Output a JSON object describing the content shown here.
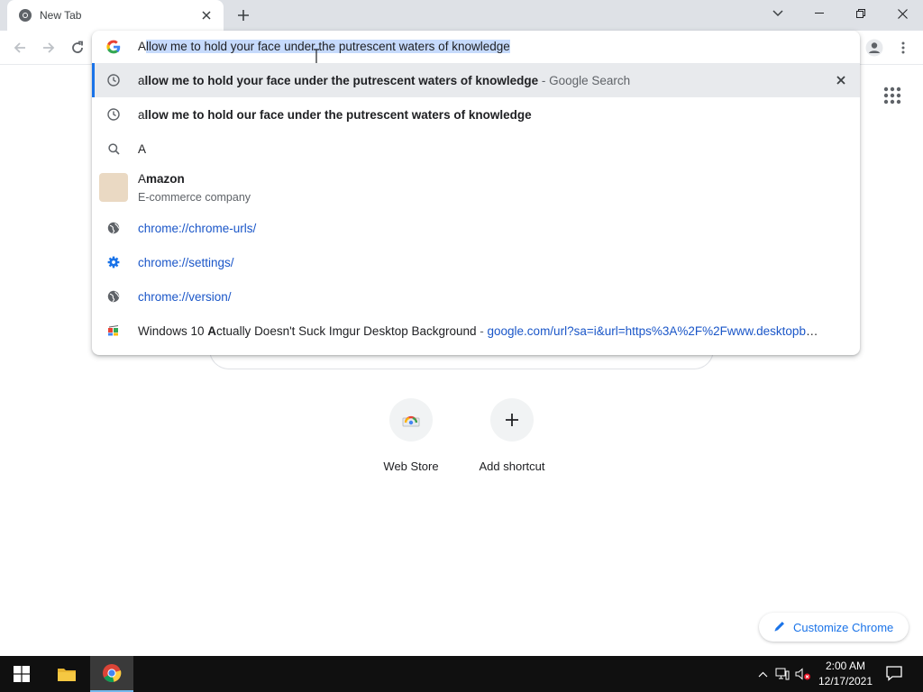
{
  "tab": {
    "title": "New Tab"
  },
  "omnibox": {
    "text_first": "A",
    "text_selected": "llow me to hold your face under the putrescent waters of knowledge"
  },
  "suggestions": [
    {
      "kind": "history",
      "icon": "clock-icon",
      "prefix": "a",
      "bold": "llow me to hold your face under the putrescent waters of knowledge",
      "desc": " - Google Search",
      "selected": true
    },
    {
      "kind": "history",
      "icon": "clock-icon",
      "prefix": "a",
      "bold": "llow me to hold our face under the putrescent waters of knowledge"
    },
    {
      "kind": "search",
      "icon": "search-icon",
      "text": "A"
    },
    {
      "kind": "entity",
      "title_prefix": "A",
      "title_bold": "mazon",
      "subtitle": "E-commerce company"
    },
    {
      "kind": "url",
      "icon": "globe-icon",
      "url": "chrome://chrome-urls/"
    },
    {
      "kind": "url",
      "icon": "settings-icon",
      "url": "chrome://settings/"
    },
    {
      "kind": "url",
      "icon": "globe-icon",
      "url": "chrome://version/"
    },
    {
      "kind": "page",
      "icon": "site-favicon",
      "t1": "Windows 10 ",
      "t_bold": "A",
      "t2": "ctually Doesn't Suck Imgur Desktop Background",
      "sep": " - ",
      "url": "google.com/url?sa=i&url=https%3A%2F%2Fwww.desktopbac..."
    }
  ],
  "shortcuts": [
    {
      "label": "Web Store"
    },
    {
      "label": "Add shortcut"
    }
  ],
  "customize": {
    "label": "Customize Chrome"
  },
  "clock": {
    "time": "2:00 AM",
    "date": "12/17/2021"
  },
  "colors": {
    "accent": "#1a73e8",
    "selection": "#c6dafc",
    "tabstrip": "#dee1e6",
    "taskbar": "#101010"
  }
}
